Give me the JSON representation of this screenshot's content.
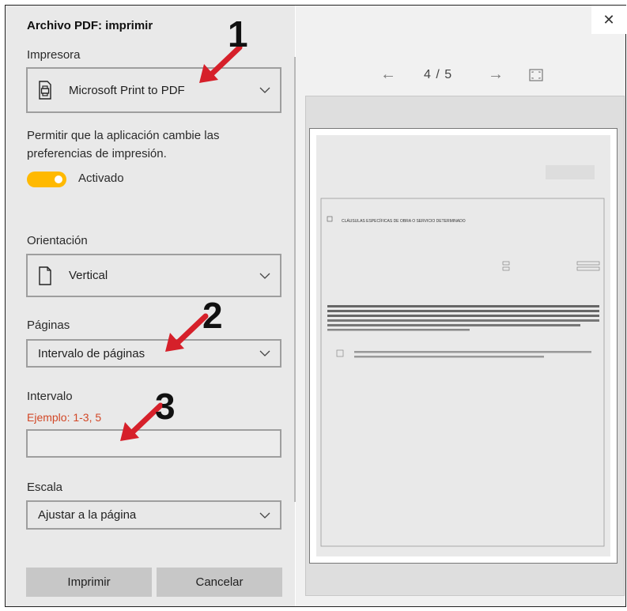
{
  "dialog": {
    "title": "Archivo PDF: imprimir",
    "close_glyph": "✕"
  },
  "printer": {
    "label": "Impresora",
    "value": "Microsoft Print to PDF",
    "icon": "printer-icon"
  },
  "app_prefs": {
    "description": "Permitir que la aplicación cambie las preferencias de impresión.",
    "toggle_state": "Activado",
    "toggle_on": true,
    "accent_color": "#ffb900"
  },
  "orientation": {
    "label": "Orientación",
    "value": "Vertical",
    "icon": "page-icon"
  },
  "pages": {
    "label": "Páginas",
    "value": "Intervalo de páginas"
  },
  "range": {
    "label": "Intervalo",
    "hint": "Ejemplo: 1-3, 5",
    "hint_color": "#d24726",
    "value": ""
  },
  "scale": {
    "label": "Escala",
    "value": "Ajustar a la página"
  },
  "buttons": {
    "print": "Imprimir",
    "cancel": "Cancelar"
  },
  "preview": {
    "page_indicator": "4 / 5",
    "prev_glyph": "←",
    "next_glyph": "→",
    "doc_heading": "CLÁUSULAS ESPECÍFICAS DE OBRA O SERVICIO DETERMINADO"
  },
  "annotations": {
    "marker_1": "1",
    "marker_2": "2",
    "marker_3": "3",
    "arrow_color": "#d6202a"
  }
}
